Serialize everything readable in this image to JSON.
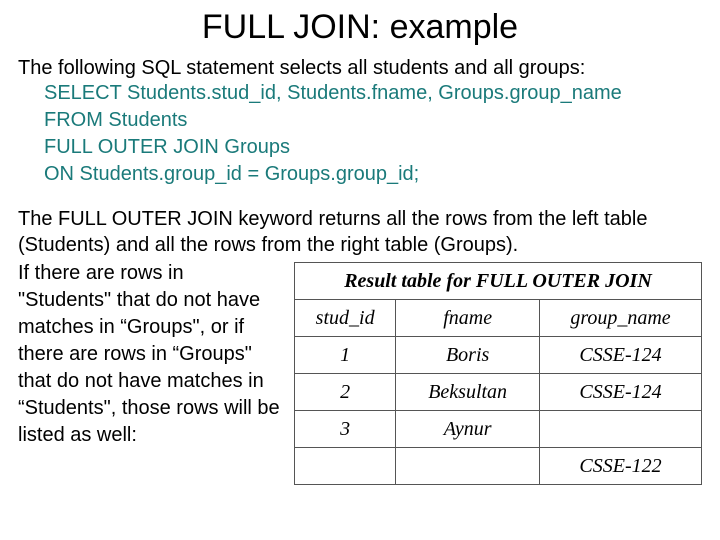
{
  "title": "FULL JOIN: example",
  "intro": "The following SQL statement selects all students and all groups:",
  "sql": {
    "l1": "SELECT Students.stud_id, Students.fname, Groups.group_name",
    "l2": "FROM Students",
    "l3": "FULL OUTER JOIN Groups",
    "l4": "ON Students.group_id = Groups.group_id;"
  },
  "para_full_1": "The FULL OUTER JOIN keyword returns all the rows from the left table (Students) and all the rows from the right table (Groups).",
  "side_text": "If there are rows in \"Students\" that do not have matches in “Groups\", or if there are rows in “Groups\" that do not have matches in “Students\", those rows will be listed as well:",
  "table": {
    "caption": "Result table for FULL OUTER JOIN",
    "headers": {
      "c1": "stud_id",
      "c2": "fname",
      "c3": "group_name"
    },
    "rows": [
      {
        "c1": "1",
        "c2": "Boris",
        "c3": "CSSE-124"
      },
      {
        "c1": "2",
        "c2": "Beksultan",
        "c3": "CSSE-124"
      },
      {
        "c1": "3",
        "c2": "Aynur",
        "c3": ""
      },
      {
        "c1": "",
        "c2": "",
        "c3": "CSSE-122"
      }
    ]
  }
}
